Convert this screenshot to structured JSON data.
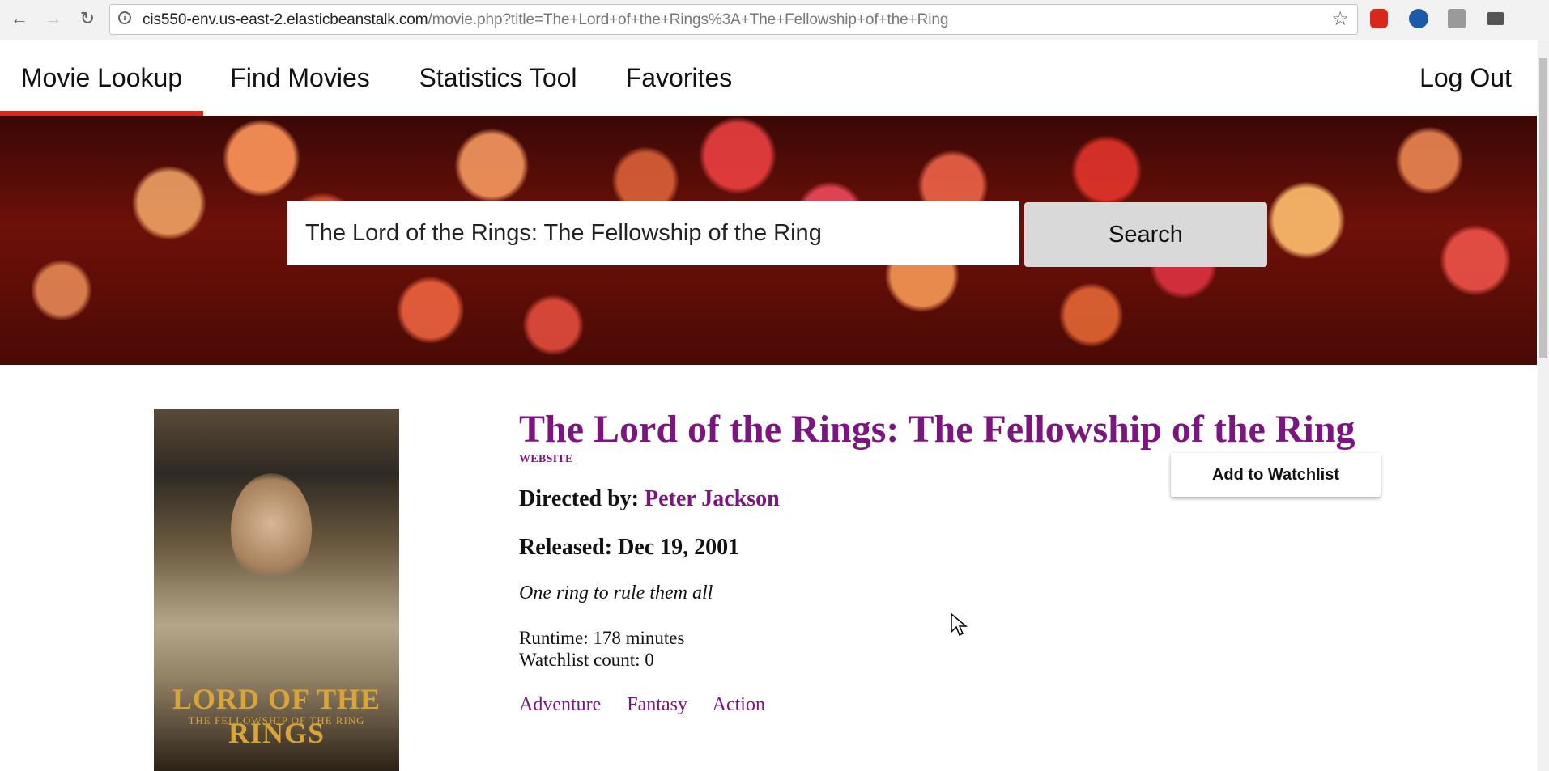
{
  "browser": {
    "url_host": "cis550-env.us-east-2.elasticbeanstalk.com",
    "url_path": "/movie.php?title=The+Lord+of+the+Rings%3A+The+Fellowship+of+the+Ring"
  },
  "nav": {
    "tabs": [
      {
        "label": "Movie Lookup",
        "active": true
      },
      {
        "label": "Find Movies"
      },
      {
        "label": "Statistics Tool"
      },
      {
        "label": "Favorites"
      }
    ],
    "logout_label": "Log Out",
    "accent_color": "#d9271c"
  },
  "search": {
    "value": "The Lord of the Rings: The Fellowship of the Ring",
    "button_label": "Search"
  },
  "movie": {
    "title": "The Lord of the Rings: The Fellowship of the Ring",
    "website_label": "WEBSITE",
    "watchlist_button": "Add to Watchlist",
    "directed_label": "Directed by:",
    "director": "Peter Jackson",
    "released_text": "Released: Dec 19, 2001",
    "tagline": "One ring to rule them all",
    "runtime_text": "Runtime: 178 minutes",
    "watchlist_count_text": "Watchlist count: 0",
    "genres": [
      "Adventure",
      "Fantasy",
      "Action"
    ],
    "poster": {
      "logo": "LORD OF THE RINGS",
      "subtitle": "THE FELLOWSHIP OF THE RING"
    },
    "accent_color": "#7b1680"
  }
}
